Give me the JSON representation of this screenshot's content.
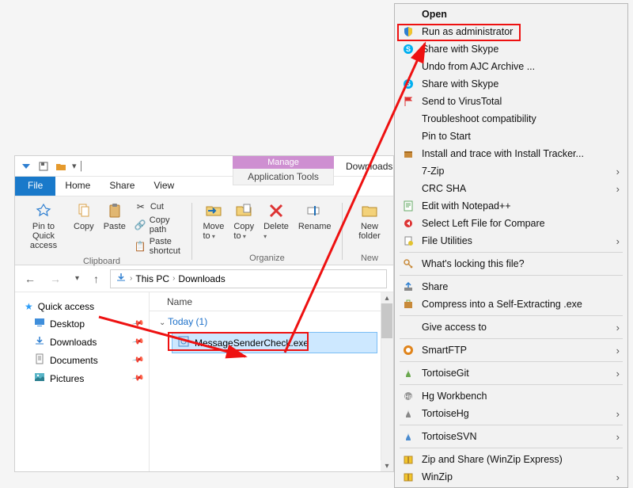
{
  "explorer": {
    "manage_label": "Manage",
    "manage_sub": "Application Tools",
    "downloads_tab": "Downloads",
    "tabs": {
      "file": "File",
      "home": "Home",
      "share": "Share",
      "view": "View"
    },
    "ribbon": {
      "pin": "Pin to Quick access",
      "copy": "Copy",
      "paste": "Paste",
      "cut": "Cut",
      "copy_path": "Copy path",
      "paste_shortcut": "Paste shortcut",
      "clipboard_group": "Clipboard",
      "move_to": "Move to",
      "copy_to": "Copy to",
      "delete": "Delete",
      "rename": "Rename",
      "organize_group": "Organize",
      "new_folder": "New folder",
      "new_group": "New"
    },
    "breadcrumb": {
      "root": "This PC",
      "folder": "Downloads"
    },
    "sidebar": {
      "quick_access": "Quick access",
      "items": [
        {
          "label": "Desktop"
        },
        {
          "label": "Downloads"
        },
        {
          "label": "Documents"
        },
        {
          "label": "Pictures"
        }
      ]
    },
    "columns": {
      "name": "Name"
    },
    "group_label": "Today (1)",
    "file_name": "MessageSenderCheck.exe"
  },
  "ctx": {
    "items": [
      {
        "label": "Open",
        "bold": true
      },
      {
        "label": "Run as administrator",
        "icon": "shield"
      },
      {
        "label": "Share with Skype",
        "icon": "skype"
      },
      {
        "label": "Undo from AJC Archive ..."
      },
      {
        "label": "Share with Skype",
        "icon": "skype"
      },
      {
        "label": "Send to VirusTotal",
        "icon": "flag"
      },
      {
        "label": "Troubleshoot compatibility"
      },
      {
        "label": "Pin to Start"
      },
      {
        "label": "Install and trace with Install Tracker...",
        "icon": "box"
      },
      {
        "label": "7-Zip",
        "sub": true
      },
      {
        "label": "CRC SHA",
        "sub": true
      },
      {
        "label": "Edit with Notepad++",
        "icon": "npp"
      },
      {
        "label": "Select Left File for Compare",
        "icon": "selleft"
      },
      {
        "label": "File Utilities",
        "icon": "fileutil",
        "sub": true
      },
      {
        "sep": true
      },
      {
        "label": "What's locking this file?",
        "icon": "key"
      },
      {
        "sep": true
      },
      {
        "label": "Share",
        "icon": "share"
      },
      {
        "label": "Compress into a Self-Extracting .exe",
        "icon": "sfx"
      },
      {
        "sep": true
      },
      {
        "label": "Give access to",
        "sub": true
      },
      {
        "sep": true
      },
      {
        "label": "SmartFTP",
        "icon": "smartftp",
        "sub": true
      },
      {
        "sep": true
      },
      {
        "label": "TortoiseGit",
        "icon": "tgit",
        "sub": true
      },
      {
        "sep": true
      },
      {
        "label": "Hg Workbench",
        "icon": "hg"
      },
      {
        "label": "TortoiseHg",
        "icon": "thg",
        "sub": true
      },
      {
        "sep": true
      },
      {
        "label": "TortoiseSVN",
        "icon": "tsvn",
        "sub": true
      },
      {
        "sep": true
      },
      {
        "label": "Zip and Share (WinZip Express)",
        "icon": "winzip"
      },
      {
        "label": "WinZip",
        "icon": "winzip",
        "sub": true
      }
    ]
  }
}
